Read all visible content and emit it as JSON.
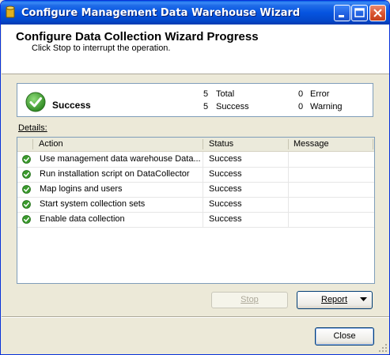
{
  "window": {
    "title": "Configure Management Data Warehouse Wizard"
  },
  "header": {
    "title": "Configure Data Collection Wizard Progress",
    "subtitle": "Click Stop to interrupt the operation."
  },
  "summary": {
    "status": "Success",
    "total_count": "5",
    "total_label": "Total",
    "success_count": "5",
    "success_label": "Success",
    "error_count": "0",
    "error_label": "Error",
    "warning_count": "0",
    "warning_label": "Warning"
  },
  "details": {
    "label": "Details:",
    "columns": {
      "action": "Action",
      "status": "Status",
      "message": "Message"
    },
    "rows": [
      {
        "action": "Use management data warehouse Data...",
        "status": "Success",
        "message": ""
      },
      {
        "action": "Run installation script on DataCollector",
        "status": "Success",
        "message": ""
      },
      {
        "action": "Map logins and users",
        "status": "Success",
        "message": ""
      },
      {
        "action": "Start system collection sets",
        "status": "Success",
        "message": ""
      },
      {
        "action": "Enable data collection",
        "status": "Success",
        "message": ""
      }
    ]
  },
  "buttons": {
    "stop": "Stop",
    "report": "Report",
    "close": "Close"
  },
  "icons": {
    "status_icon": "success-check-icon",
    "app_icon": "database-icon"
  },
  "colors": {
    "success_green": "#3a9a2c",
    "titlebar_blue": "#0554e0"
  }
}
